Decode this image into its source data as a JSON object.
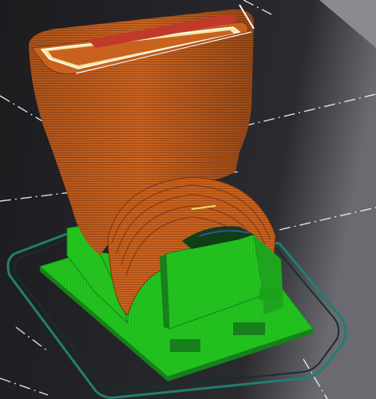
{
  "viewport": {
    "background_dark": "#1c1c1f",
    "background_light": "#6a6a70",
    "bed_outline_color": "#1f7f72",
    "grid_line_color": "#ffffff"
  },
  "model": {
    "icon": "3d-print-preview-icon",
    "colors": {
      "perimeter": "#c9621f",
      "perimeter_dark": "#9a4617",
      "top_fill": "#c0392b",
      "support": "#23c21f",
      "support_dark": "#16801a",
      "skirt": "#1f7f72",
      "highlight": "#f4e36a",
      "bridge_blue": "#3a4aa8"
    },
    "parts": [
      "duct-body",
      "duct-opening",
      "support-base",
      "support-block",
      "skirt-outline"
    ]
  }
}
